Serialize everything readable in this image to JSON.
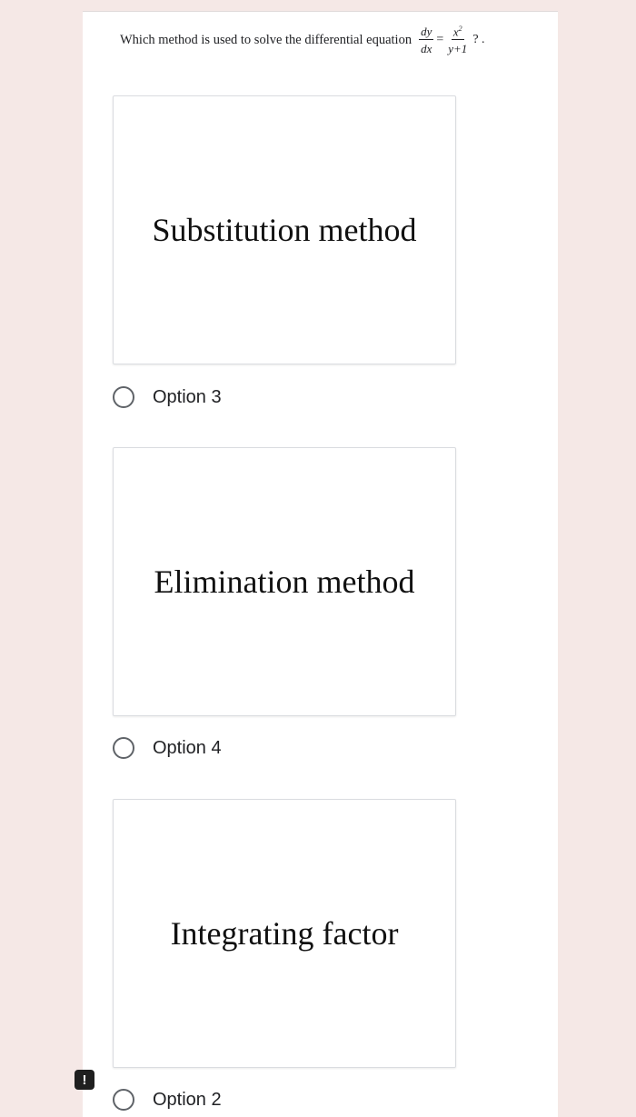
{
  "question": {
    "text": "Which method is used to solve the differential equation",
    "equation": {
      "lhs_num": "dy",
      "lhs_den": "dx",
      "equals": "=",
      "rhs_num_base": "x",
      "rhs_num_exp": "2",
      "rhs_den": "y+1"
    },
    "suffix": "? ."
  },
  "options": [
    {
      "image_text": "Substitution method",
      "label": "Option 3"
    },
    {
      "image_text": "Elimination method",
      "label": "Option 4"
    },
    {
      "image_text": "Integrating factor",
      "label": "Option 2"
    }
  ],
  "report_icon": {
    "symbol": "!",
    "icon": "report-icon"
  },
  "colors": {
    "page_background": "#f5e8e6",
    "card_background": "#ffffff",
    "radio_border": "#5f6368",
    "text": "#202124"
  }
}
